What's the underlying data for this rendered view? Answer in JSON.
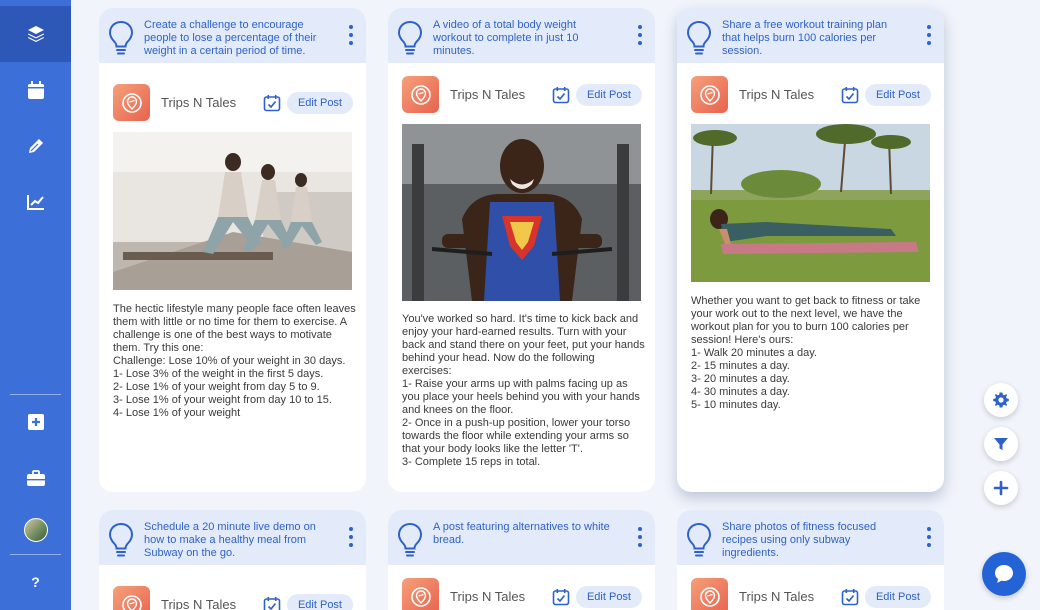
{
  "sidebar": {
    "items": [
      {
        "icon": "layers-icon"
      },
      {
        "icon": "calendar-icon"
      },
      {
        "icon": "pencil-icon"
      },
      {
        "icon": "analytics-icon"
      },
      {
        "icon": "add-square-icon"
      },
      {
        "icon": "briefcase-icon"
      },
      {
        "icon": "avatar"
      },
      {
        "icon": "help-icon",
        "label": "?"
      }
    ],
    "colors": {
      "background": "#3d6fd8",
      "active": "#2d58b8"
    }
  },
  "cards": [
    {
      "prompt": "Create a challenge to encourage people to lose a percentage of their weight in a certain period of time.",
      "author": "Trips N Tales",
      "edit_label": "Edit Post",
      "image": "women-pilates-reformer",
      "body": "The hectic lifestyle many people face often leaves them with little or no time for them to exercise. A challenge is one of the best ways to motivate them. Try this one:\nChallenge: Lose 10% of your weight in 30 days.\n1- Lose 3% of the weight in the first 5 days.\n2- Lose 1% of your weight from day 5 to 9.\n3- Lose 1% of your weight from day 10 to 15.\n4- Lose 1% of your weight"
    },
    {
      "prompt": "A video of a total body weight workout to complete in just 10 minutes.",
      "author": "Trips N Tales",
      "edit_label": "Edit Post",
      "image": "man-superman-shirt-gym",
      "body": "You've worked so hard. It's time to kick back and enjoy your hard-earned results. Turn with your back and stand there on your feet, put your hands behind your head. Now do the following exercises:\n1- Raise your arms up with palms facing up as you place your heels behind you with your hands and knees on the floor.\n2- Once in a push-up position, lower your torso towards the floor while extending your arms so that your body looks like the letter 'T'.\n3- Complete 15 reps in total."
    },
    {
      "prompt": "Share a free workout training plan that helps burn 100 calories per session.",
      "author": "Trips N Tales",
      "edit_label": "Edit Post",
      "image": "woman-plank-park",
      "body": "Whether you want to get back to fitness or take your work out to the next level, we have the workout plan for you to burn 100 calories per session! Here's ours:\n1- Walk 20 minutes a day.\n2- 15 minutes a day.\n3- 20 minutes a day.\n4- 30 minutes a day.\n5- 10 minutes day."
    },
    {
      "prompt": "Schedule a 20 minute live demo on how to make a healthy meal from Subway on the go.",
      "author": "Trips N Tales",
      "edit_label": "Edit Post"
    },
    {
      "prompt": "A post featuring alternatives to white bread.",
      "author": "Trips N Tales",
      "edit_label": "Edit Post"
    },
    {
      "prompt": "Share photos of fitness focused recipes using only subway ingredients.",
      "author": "Trips N Tales",
      "edit_label": "Edit Post"
    }
  ],
  "floating": [
    {
      "icon": "gear-icon"
    },
    {
      "icon": "filter-icon"
    },
    {
      "icon": "plus-icon"
    }
  ],
  "chat": {
    "icon": "chat-bubble-icon"
  },
  "colors": {
    "accent": "#2f62c9",
    "header_bg": "#e3ebfb",
    "page_bg": "#f1f4fb",
    "chat": "#2463d6"
  }
}
